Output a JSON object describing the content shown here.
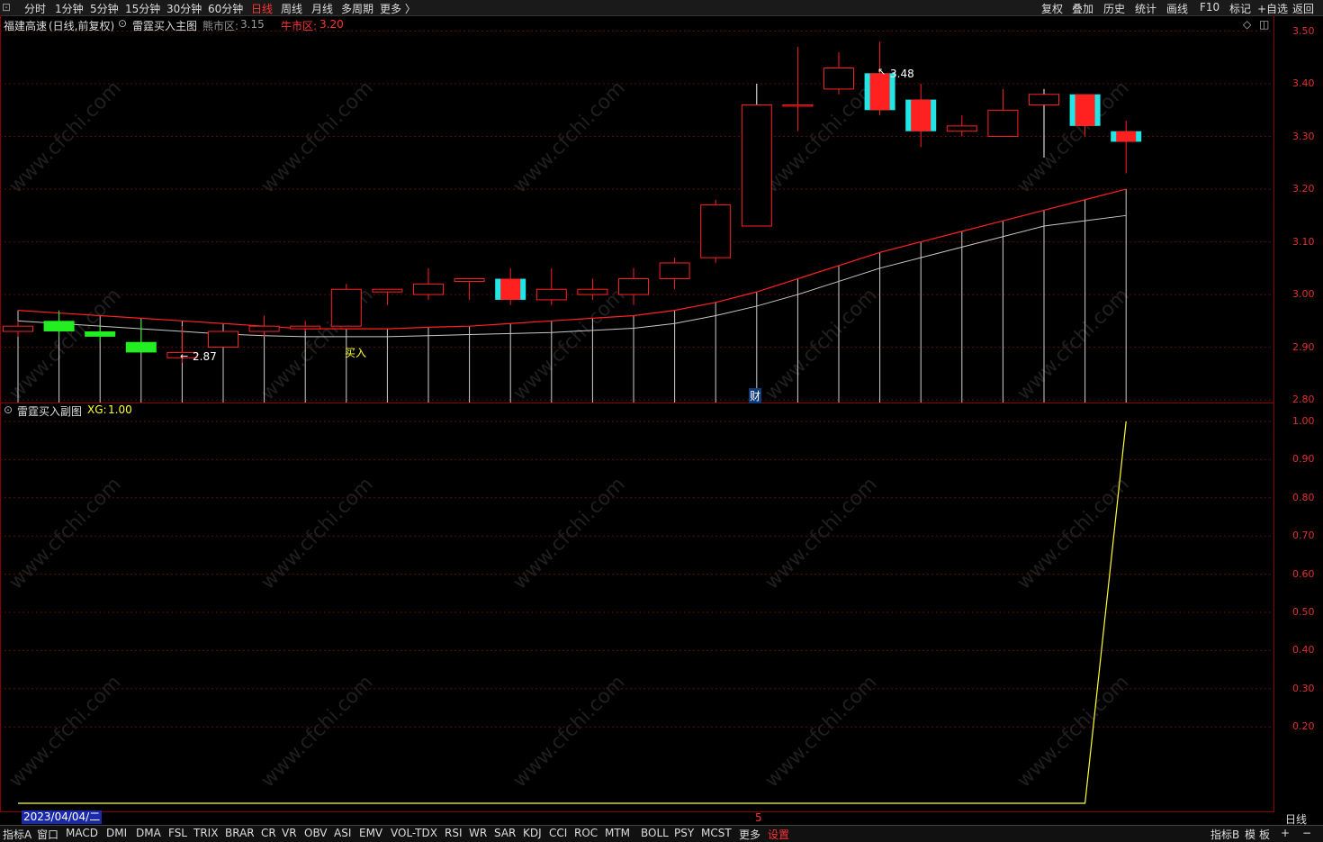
{
  "topbar": {
    "left_items": [
      "分时",
      "1分钟",
      "5分钟",
      "15分钟",
      "30分钟",
      "60分钟",
      "日线",
      "周线",
      "月线",
      "多周期",
      "更多 〉"
    ],
    "active": "日线",
    "right_items": [
      "复权",
      "叠加",
      "历史",
      "统计",
      "画线",
      "F10",
      "标记",
      "+自选",
      "返回"
    ]
  },
  "main_title": {
    "stock": "福建高速",
    "period": "(日线,前复权)",
    "indicator": "雷霆买入主图",
    "bear_label": "熊市区:",
    "bear_value": "3.15",
    "bull_label": "牛市区:",
    "bull_value": "3.20"
  },
  "sub_title": {
    "indicator": "雷霆买入副图",
    "xg_label": "XG:",
    "xg_value": "1.00"
  },
  "annotations": {
    "high_label": "3.48",
    "low_label": "2.87",
    "buy_label": "买入",
    "cai_label": "财",
    "month_marker": "5",
    "period_label": "日线"
  },
  "date_box": "2023/04/04/二",
  "watermark": "www.cfchi.com",
  "colors": {
    "up": "#ff2020",
    "down": "#22ee22",
    "signal": "#22e5e5",
    "bull_line": "#ff2020",
    "bear_line": "#c8c8c8",
    "xg_line": "#ffff33",
    "axis": "#e03030"
  },
  "chart_data": [
    {
      "type": "candlestick",
      "title": "福建高速 (日线,前复权)",
      "y_ticks": [
        "3.50",
        "3.40",
        "3.30",
        "3.20",
        "3.10",
        "3.00",
        "2.90",
        "2.80"
      ],
      "ylim": [
        2.795,
        3.53
      ],
      "candles": [
        {
          "o": 2.93,
          "h": 2.95,
          "l": 2.92,
          "c": 2.94,
          "dir": "up"
        },
        {
          "o": 2.95,
          "h": 2.97,
          "l": 2.92,
          "c": 2.93,
          "dir": "down"
        },
        {
          "o": 2.93,
          "h": 2.94,
          "l": 2.91,
          "c": 2.92,
          "dir": "down"
        },
        {
          "o": 2.91,
          "h": 2.95,
          "l": 2.89,
          "c": 2.89,
          "dir": "down"
        },
        {
          "o": 2.88,
          "h": 2.94,
          "l": 2.87,
          "c": 2.89,
          "dir": "up"
        },
        {
          "o": 2.9,
          "h": 2.93,
          "l": 2.9,
          "c": 2.93,
          "dir": "up"
        },
        {
          "o": 2.93,
          "h": 2.96,
          "l": 2.92,
          "c": 2.94,
          "dir": "up"
        },
        {
          "o": 2.935,
          "h": 2.95,
          "l": 2.93,
          "c": 2.94,
          "dir": "up"
        },
        {
          "o": 2.94,
          "h": 3.02,
          "l": 2.94,
          "c": 3.01,
          "dir": "up"
        },
        {
          "o": 3.005,
          "h": 3.01,
          "l": 2.98,
          "c": 3.01,
          "dir": "up"
        },
        {
          "o": 3.0,
          "h": 3.05,
          "l": 2.99,
          "c": 3.02,
          "dir": "up"
        },
        {
          "o": 3.025,
          "h": 3.03,
          "l": 2.99,
          "c": 3.03,
          "dir": "up"
        },
        {
          "o": 2.99,
          "h": 3.05,
          "l": 2.98,
          "c": 3.03,
          "dir": "up",
          "signal": true
        },
        {
          "o": 2.99,
          "h": 3.05,
          "l": 2.98,
          "c": 3.01,
          "dir": "up"
        },
        {
          "o": 3.0,
          "h": 3.03,
          "l": 2.99,
          "c": 3.01,
          "dir": "up"
        },
        {
          "o": 3.0,
          "h": 3.05,
          "l": 2.98,
          "c": 3.03,
          "dir": "up"
        },
        {
          "o": 3.03,
          "h": 3.07,
          "l": 3.01,
          "c": 3.06,
          "dir": "up"
        },
        {
          "o": 3.07,
          "h": 3.18,
          "l": 3.06,
          "c": 3.17,
          "dir": "up"
        },
        {
          "o": 3.13,
          "h": 3.4,
          "l": 3.13,
          "c": 3.36,
          "dir": "up"
        },
        {
          "o": 3.36,
          "h": 3.47,
          "l": 3.31,
          "c": 3.36,
          "dir": "up"
        },
        {
          "o": 3.39,
          "h": 3.46,
          "l": 3.38,
          "c": 3.43,
          "dir": "up"
        },
        {
          "o": 3.35,
          "h": 3.48,
          "l": 3.34,
          "c": 3.42,
          "dir": "up",
          "signal": true
        },
        {
          "o": 3.31,
          "h": 3.4,
          "l": 3.28,
          "c": 3.37,
          "dir": "up",
          "signal": true
        },
        {
          "o": 3.31,
          "h": 3.34,
          "l": 3.3,
          "c": 3.32,
          "dir": "up"
        },
        {
          "o": 3.3,
          "h": 3.39,
          "l": 3.3,
          "c": 3.35,
          "dir": "up"
        },
        {
          "o": 3.36,
          "h": 3.39,
          "l": 3.26,
          "c": 3.38,
          "dir": "up"
        },
        {
          "o": 3.32,
          "h": 3.38,
          "l": 3.3,
          "c": 3.38,
          "dir": "up",
          "signal": true
        },
        {
          "o": 3.29,
          "h": 3.33,
          "l": 3.23,
          "c": 3.31,
          "dir": "up",
          "signal": true
        }
      ],
      "series": [
        {
          "name": "牛市区",
          "values": [
            2.97,
            2.965,
            2.96,
            2.955,
            2.95,
            2.945,
            2.94,
            2.935,
            2.935,
            2.935,
            2.938,
            2.94,
            2.945,
            2.95,
            2.955,
            2.96,
            2.97,
            2.985,
            3.005,
            3.03,
            3.055,
            3.08,
            3.1,
            3.12,
            3.14,
            3.16,
            3.18,
            3.2
          ]
        },
        {
          "name": "熊市区",
          "values": [
            2.95,
            2.945,
            2.94,
            2.935,
            2.93,
            2.925,
            2.922,
            2.92,
            2.92,
            2.92,
            2.922,
            2.924,
            2.926,
            2.928,
            2.932,
            2.936,
            2.945,
            2.96,
            2.978,
            3.0,
            3.025,
            3.05,
            3.07,
            3.09,
            3.11,
            3.13,
            3.14,
            3.15
          ]
        }
      ]
    },
    {
      "type": "line",
      "title": "雷霆买入副图",
      "y_ticks": [
        "1.00",
        "0.90",
        "0.80",
        "0.70",
        "0.60",
        "0.50",
        "0.40",
        "0.30",
        "0.20"
      ],
      "series": [
        {
          "name": "XG",
          "values": [
            0,
            0,
            0,
            0,
            0,
            0,
            0,
            0,
            0,
            0,
            0,
            0,
            0,
            0,
            0,
            0,
            0,
            0,
            0,
            0,
            0,
            0,
            0,
            0,
            0,
            0,
            0,
            1
          ]
        }
      ]
    }
  ],
  "bottombar": {
    "tabs": [
      "指标A",
      "窗口",
      "MACD",
      "DMI",
      "DMA",
      "FSL",
      "TRIX",
      "BRAR",
      "CR",
      "VR",
      "OBV",
      "ASI",
      "EMV",
      "VOL-TDX",
      "RSI",
      "WR",
      "SAR",
      "KDJ",
      "CCI",
      "ROC",
      "MTM",
      "BOLL",
      "PSY",
      "MCST",
      "更多",
      "设置"
    ],
    "right": [
      "指标B",
      "模",
      "板",
      "+",
      "−"
    ]
  }
}
